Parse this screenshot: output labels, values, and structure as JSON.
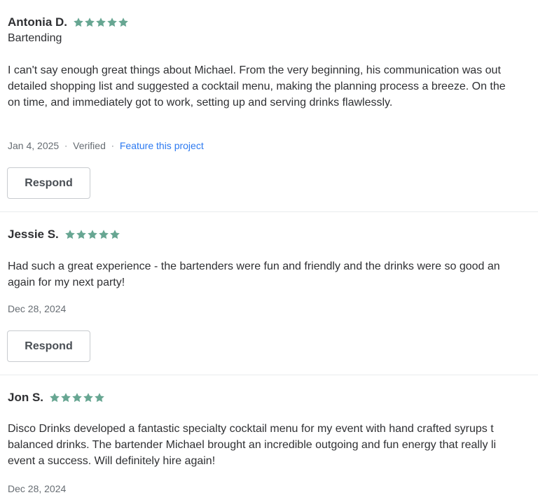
{
  "colors": {
    "star": "#67a692",
    "link": "#2d7af1",
    "text": "#2f3033",
    "muted": "#676d73",
    "divider": "#e9eced",
    "button_border": "#c8cbcf"
  },
  "reviews": [
    {
      "name": "Antonia D.",
      "rating": 5,
      "service": "Bartending",
      "text_lines": [
        "I can't say enough great things about Michael. From the very beginning, his communication was out",
        "detailed shopping list and suggested a cocktail menu, making the planning process a breeze. On the",
        "on time, and immediately got to work, setting up and serving drinks flawlessly."
      ],
      "date": "Jan 4, 2025",
      "verified": "Verified",
      "feature_link": "Feature this project",
      "separator": "·",
      "respond_label": "Respond"
    },
    {
      "name": "Jessie S.",
      "rating": 5,
      "text_lines": [
        "Had such a great experience - the bartenders were fun and friendly and the drinks were so good an",
        "again for my next party!"
      ],
      "date": "Dec 28, 2024",
      "respond_label": "Respond"
    },
    {
      "name": "Jon S.",
      "rating": 5,
      "text_lines": [
        "Disco Drinks developed a fantastic specialty cocktail menu for my event with hand crafted syrups t",
        "balanced drinks. The bartender Michael brought an incredible outgoing and fun energy that really li",
        "event a success. Will definitely hire again!"
      ],
      "date": "Dec 28, 2024"
    }
  ]
}
